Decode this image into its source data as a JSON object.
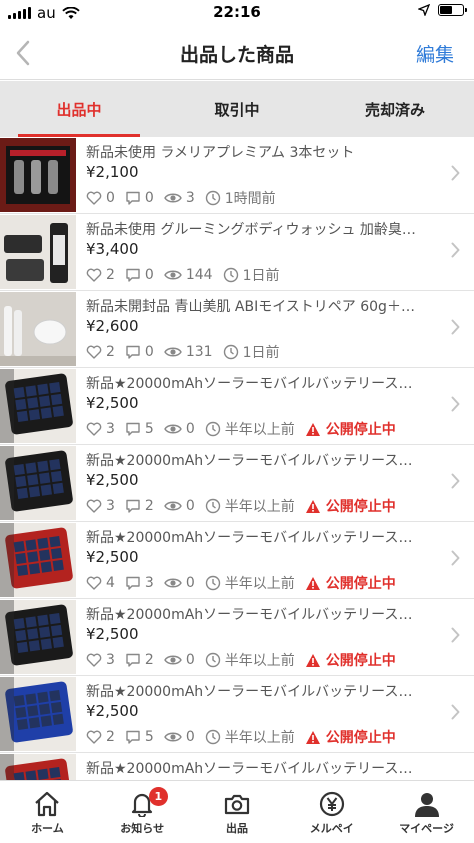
{
  "status_bar": {
    "carrier": "au",
    "time": "22:16"
  },
  "nav": {
    "title": "出品した商品",
    "edit_label": "編集"
  },
  "tabs": [
    {
      "label": "出品中",
      "active": true
    },
    {
      "label": "取引中",
      "active": false
    },
    {
      "label": "売却済み",
      "active": false
    }
  ],
  "items": [
    {
      "title": "新品未使用 ラメリアプレミアム 3本セット",
      "price": "¥2,100",
      "likes": "0",
      "comments": "0",
      "views": "3",
      "time": "1時間前",
      "status": ""
    },
    {
      "title": "新品未使用 グルーミングボディウォッシュ 加齢臭…",
      "price": "¥3,400",
      "likes": "2",
      "comments": "0",
      "views": "144",
      "time": "1日前",
      "status": ""
    },
    {
      "title": "新品未開封品 青山美肌 ABIモイストリペア 60g＋…",
      "price": "¥2,600",
      "likes": "2",
      "comments": "0",
      "views": "131",
      "time": "1日前",
      "status": ""
    },
    {
      "title": "新品★20000mAhソーラーモバイルバッテリース…",
      "price": "¥2,500",
      "likes": "3",
      "comments": "5",
      "views": "0",
      "time": "半年以上前",
      "status": "公開停止中"
    },
    {
      "title": "新品★20000mAhソーラーモバイルバッテリース…",
      "price": "¥2,500",
      "likes": "3",
      "comments": "2",
      "views": "0",
      "time": "半年以上前",
      "status": "公開停止中"
    },
    {
      "title": "新品★20000mAhソーラーモバイルバッテリース…",
      "price": "¥2,500",
      "likes": "4",
      "comments": "3",
      "views": "0",
      "time": "半年以上前",
      "status": "公開停止中"
    },
    {
      "title": "新品★20000mAhソーラーモバイルバッテリース…",
      "price": "¥2,500",
      "likes": "3",
      "comments": "2",
      "views": "0",
      "time": "半年以上前",
      "status": "公開停止中"
    },
    {
      "title": "新品★20000mAhソーラーモバイルバッテリース…",
      "price": "¥2,500",
      "likes": "2",
      "comments": "5",
      "views": "0",
      "time": "半年以上前",
      "status": "公開停止中"
    },
    {
      "title": "新品★20000mAhソーラーモバイルバッテリース…",
      "price": "¥2,500",
      "likes": "",
      "comments": "",
      "views": "",
      "time": "",
      "status": ""
    }
  ],
  "tabbar": [
    {
      "label": "ホーム",
      "icon": "home-icon"
    },
    {
      "label": "お知らせ",
      "icon": "bell-icon",
      "badge": "1"
    },
    {
      "label": "出品",
      "icon": "camera-icon"
    },
    {
      "label": "メルペイ",
      "icon": "yen-icon"
    },
    {
      "label": "マイページ",
      "icon": "person-icon"
    }
  ],
  "colors": {
    "accent": "#e0302c",
    "link": "#2f7bd8",
    "tab_bg": "#e6e6e6"
  }
}
